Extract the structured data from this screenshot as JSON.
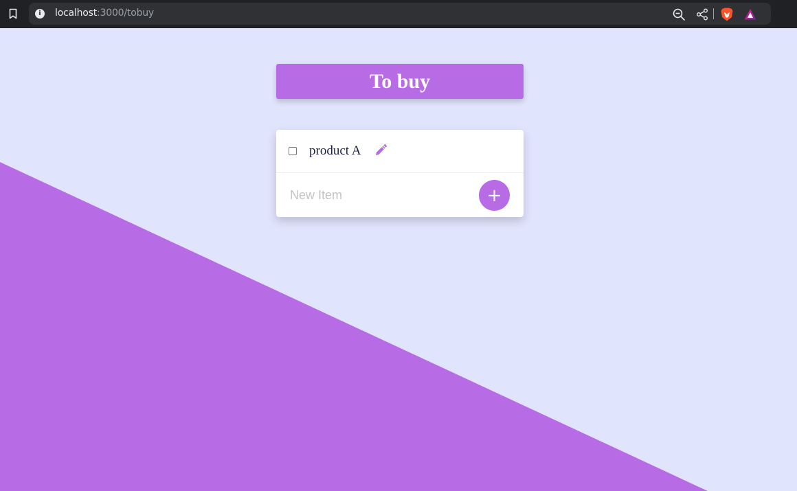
{
  "browser": {
    "url_host": "localhost",
    "url_rest": ":3000/tobuy"
  },
  "page": {
    "title": "To buy",
    "items": [
      {
        "label": "product A",
        "checked": false
      }
    ],
    "new_item": {
      "placeholder": "New Item",
      "value": ""
    },
    "add_label": "+"
  },
  "colors": {
    "accent": "#b76be5",
    "background": "#e1e4fd",
    "item_text": "#1a1e3d"
  },
  "icons": [
    "bookmark-icon",
    "info-icon",
    "zoom-out-icon",
    "share-icon",
    "brave-lion-icon",
    "brave-rewards-icon",
    "pencil-icon",
    "plus-icon"
  ]
}
